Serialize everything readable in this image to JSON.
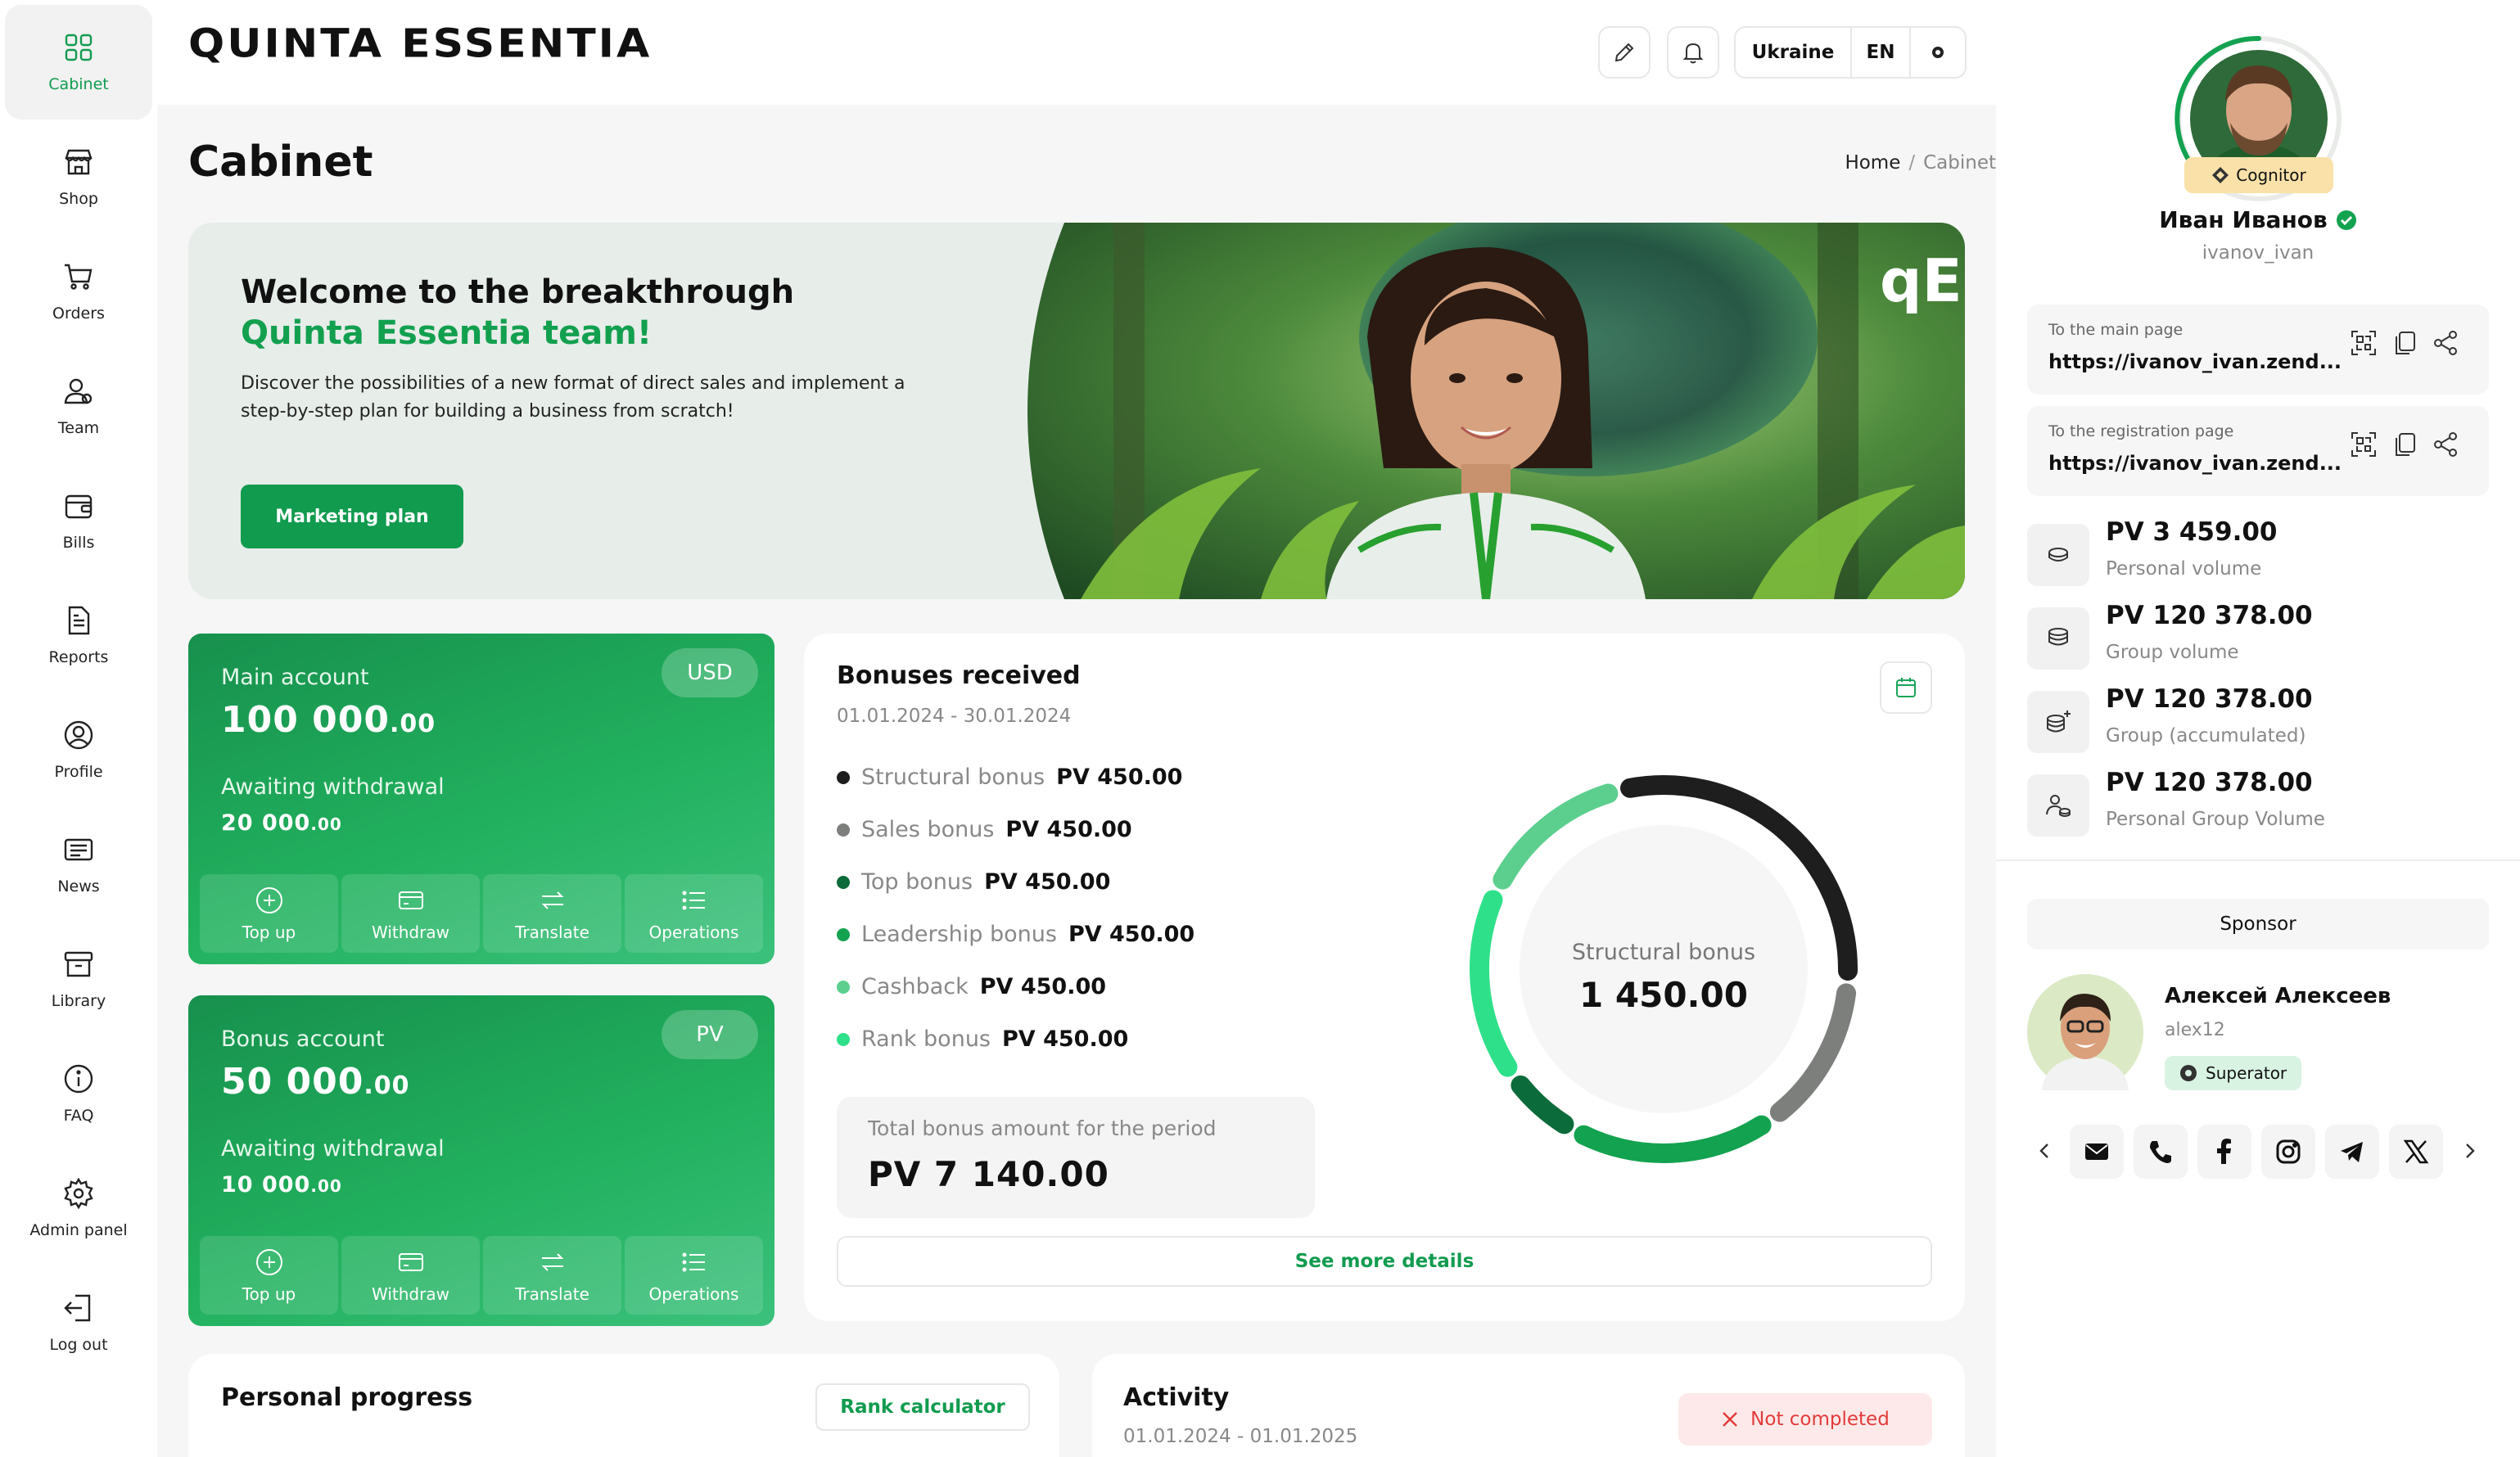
{
  "brand": {
    "name": "QUINTA ESSENTIA",
    "accent": "#119b4f"
  },
  "sidebar": {
    "items": [
      {
        "label": "Cabinet",
        "icon": "grid-icon",
        "active": true
      },
      {
        "label": "Shop",
        "icon": "store-icon"
      },
      {
        "label": "Orders",
        "icon": "cart-icon"
      },
      {
        "label": "Team",
        "icon": "team-icon"
      },
      {
        "label": "Bills",
        "icon": "wallet-icon"
      },
      {
        "label": "Reports",
        "icon": "document-icon"
      },
      {
        "label": "Profile",
        "icon": "profile-icon"
      },
      {
        "label": "News",
        "icon": "news-icon"
      },
      {
        "label": "Library",
        "icon": "archive-icon"
      },
      {
        "label": "FAQ",
        "icon": "info-icon"
      },
      {
        "label": "Admin panel",
        "icon": "gear-icon"
      },
      {
        "label": "Log out",
        "icon": "logout-icon"
      }
    ]
  },
  "header": {
    "country": "Ukraine",
    "language": "EN"
  },
  "page": {
    "title": "Cabinet",
    "breadcrumb": {
      "home": "Home",
      "separator": "/",
      "current": "Cabinet"
    }
  },
  "hero": {
    "title_line1": "Welcome to the breakthrough",
    "title_line2": "Quinta Essentia team!",
    "text": "Discover the possibilities of a new format of direct sales and implement a step-by-step plan for building a business from scratch!",
    "button": "Marketing plan",
    "logo_mark": "qE"
  },
  "accounts": [
    {
      "label": "Main account",
      "currency": "USD",
      "amount": "100 000",
      "cents": ".00",
      "awaiting_label": "Awaiting withdrawal",
      "awaiting": "20 000",
      "awaiting_cents": ".00",
      "actions": [
        "Top up",
        "Withdraw",
        "Translate",
        "Operations"
      ]
    },
    {
      "label": "Bonus account",
      "currency": "PV",
      "amount": "50 000",
      "cents": ".00",
      "awaiting_label": "Awaiting withdrawal",
      "awaiting": "10 000",
      "awaiting_cents": ".00",
      "actions": [
        "Top up",
        "Withdraw",
        "Translate",
        "Operations"
      ]
    }
  ],
  "bonuses": {
    "title": "Bonuses received",
    "period": "01.01.2024 - 30.01.2024",
    "items": [
      {
        "name": "Structural bonus",
        "value": "PV 450.00",
        "color": "#1e1e1e"
      },
      {
        "name": "Sales bonus",
        "value": "PV 450.00",
        "color": "#7d7f7d"
      },
      {
        "name": "Top bonus",
        "value": "PV 450.00",
        "color": "#0c6b3a"
      },
      {
        "name": "Leadership bonus",
        "value": "PV 450.00",
        "color": "#13a250"
      },
      {
        "name": "Cashback",
        "value": "PV 450.00",
        "color": "#5ccf8f"
      },
      {
        "name": "Rank bonus",
        "value": "PV 450.00",
        "color": "#2fe08a"
      }
    ],
    "total_label": "Total bonus amount for the period",
    "total": "PV 7 140.00",
    "donut_label": "Structural bonus",
    "donut_value": "1 450.00",
    "more": "See more details"
  },
  "chart_data": {
    "type": "pie",
    "title": "Bonuses received",
    "categories": [
      "Structural bonus",
      "Sales bonus",
      "Leadership bonus",
      "Top bonus",
      "Rank bonus",
      "Cashback"
    ],
    "values": [
      30,
      14,
      18,
      7,
      17,
      14
    ],
    "center_label": "Structural bonus",
    "center_value": "1 450.00"
  },
  "progress": {
    "title": "Personal progress",
    "button": "Rank calculator"
  },
  "activity": {
    "title": "Activity",
    "period": "01.01.2024 - 01.01.2025",
    "status": "Not completed"
  },
  "user": {
    "name": "Иван Иванов",
    "username": "ivanov_ivan",
    "rank": "Cognitor",
    "verified": true
  },
  "links": [
    {
      "title": "To the main page",
      "url": "https://ivanov_ivan.zend..."
    },
    {
      "title": "To the registration page",
      "url": "https://ivanov_ivan.zend..."
    }
  ],
  "volumes": [
    {
      "value": "PV 3 459.00",
      "label": "Personal volume"
    },
    {
      "value": "PV 120 378.00",
      "label": "Group volume"
    },
    {
      "value": "PV 120 378.00",
      "label": "Group (accumulated)"
    },
    {
      "value": "PV 120 378.00",
      "label": "Personal Group Volume"
    }
  ],
  "sponsor": {
    "heading": "Sponsor",
    "name": "Алексей Алексеев",
    "username": "alex12",
    "rank": "Superator"
  },
  "socials": [
    "mail-icon",
    "phone-icon",
    "facebook-icon",
    "instagram-icon",
    "telegram-icon",
    "x-icon"
  ]
}
